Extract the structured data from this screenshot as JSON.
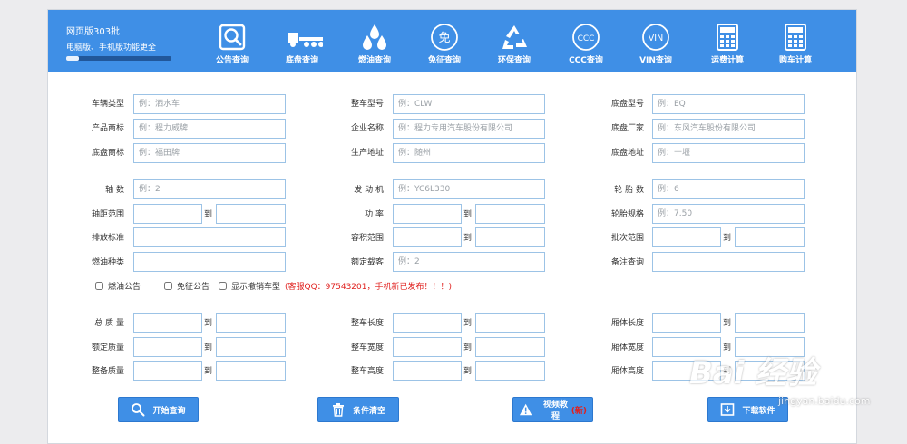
{
  "header": {
    "version": "网页版303批",
    "subtitle": "电脑版、手机版功能更全",
    "progress": 0.12,
    "nav": [
      {
        "icon": "magnifier-icon",
        "label": "公告查询"
      },
      {
        "icon": "truck-icon",
        "label": "底盘查询"
      },
      {
        "icon": "fuel-drops-icon",
        "label": "燃油查询"
      },
      {
        "icon": "exempt-icon",
        "glyph": "免",
        "label": "免征查询"
      },
      {
        "icon": "recycle-icon",
        "label": "环保查询"
      },
      {
        "icon": "ccc-icon",
        "glyph": "CCC",
        "label": "CCC查询"
      },
      {
        "icon": "vin-icon",
        "glyph": "VIN",
        "label": "VIN查询"
      },
      {
        "icon": "calculator-icon",
        "label": "运费计算"
      },
      {
        "icon": "calculator-icon",
        "label": "购车计算"
      }
    ]
  },
  "form": {
    "vehicle_type": {
      "label": "车辆类型",
      "placeholder": "例：洒水车"
    },
    "model": {
      "label": "整车型号",
      "placeholder": "例：CLW"
    },
    "chassis_model": {
      "label": "底盘型号",
      "placeholder": "例：EQ"
    },
    "brand": {
      "label": "产品商标",
      "placeholder": "例：程力威牌"
    },
    "company": {
      "label": "企业名称",
      "placeholder": "例：程力专用汽车股份有限公司"
    },
    "chassis_maker": {
      "label": "底盘厂家",
      "placeholder": "例：东风汽车股份有限公司"
    },
    "chassis_brand": {
      "label": "底盘商标",
      "placeholder": "例：福田牌"
    },
    "prod_addr": {
      "label": "生产地址",
      "placeholder": "例：随州"
    },
    "chassis_addr": {
      "label": "底盘地址",
      "placeholder": "例：十堰"
    },
    "axle": {
      "label": "轴 数",
      "placeholder": "例：2"
    },
    "engine": {
      "label": "发 动 机",
      "placeholder": "例：YC6L330"
    },
    "tires": {
      "label": "轮 胎 数",
      "placeholder": "例：6"
    },
    "wheelbase": {
      "label": "轴距范围"
    },
    "power": {
      "label": "功 率"
    },
    "tire_spec": {
      "label": "轮胎规格",
      "placeholder": "例：7.50"
    },
    "emission": {
      "label": "排放标准"
    },
    "volume": {
      "label": "容积范围"
    },
    "batch": {
      "label": "批次范围"
    },
    "fuel": {
      "label": "燃油种类"
    },
    "seats": {
      "label": "额定载客",
      "placeholder": "例：2"
    },
    "remark": {
      "label": "备注查询"
    },
    "to": "到",
    "checks": [
      "燃油公告",
      "免征公告",
      "显示撤销车型"
    ],
    "notice": "(客服QQ：97543201，手机新已发布！！！)",
    "total_mass": {
      "label": "总 质 量"
    },
    "length": {
      "label": "整车长度"
    },
    "box_length": {
      "label": "厢体长度"
    },
    "rated_mass": {
      "label": "额定质量"
    },
    "width": {
      "label": "整车宽度"
    },
    "box_width": {
      "label": "厢体宽度"
    },
    "curb_mass": {
      "label": "整备质量"
    },
    "height": {
      "label": "整车高度"
    },
    "box_height": {
      "label": "厢体高度"
    }
  },
  "buttons": {
    "search": "开始查询",
    "clear": "条件清空",
    "video": "视频教程",
    "video_new": "(新)",
    "download": "下载软件"
  },
  "watermark": {
    "text": "Bai 经验",
    "sub": "jingyan.baidu.com"
  }
}
